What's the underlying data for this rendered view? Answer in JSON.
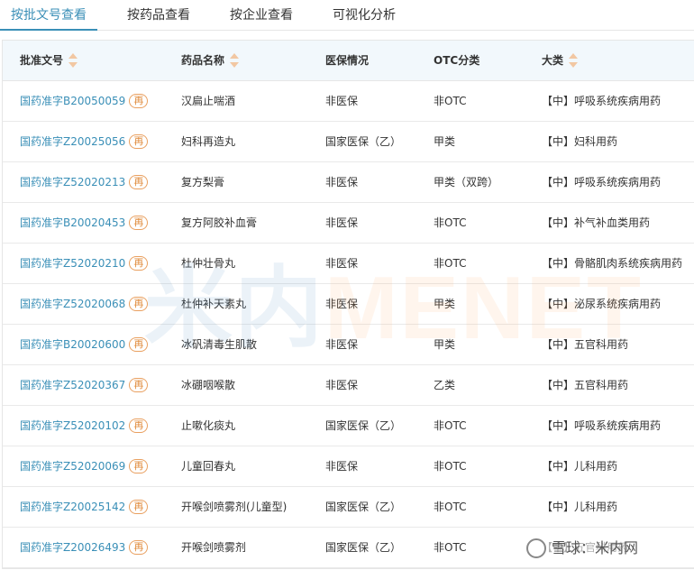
{
  "tabs": [
    {
      "label": "按批文号查看",
      "active": true
    },
    {
      "label": "按药品查看",
      "active": false
    },
    {
      "label": "按企业查看",
      "active": false
    },
    {
      "label": "可视化分析",
      "active": false
    }
  ],
  "columns": [
    "批准文号",
    "药品名称",
    "医保情况",
    "OTC分类",
    "大类"
  ],
  "badge_label": "再",
  "rows": [
    {
      "approval": "国药准字B20050059",
      "name": "汉扁止喘酒",
      "insurance": "非医保",
      "otc": "非OTC",
      "category": "【中】呼吸系统疾病用药"
    },
    {
      "approval": "国药准字Z20025056",
      "name": "妇科再造丸",
      "insurance": "国家医保（乙）",
      "otc": "甲类",
      "category": "【中】妇科用药"
    },
    {
      "approval": "国药准字Z52020213",
      "name": "复方梨膏",
      "insurance": "非医保",
      "otc": "甲类（双跨）",
      "category": "【中】呼吸系统疾病用药"
    },
    {
      "approval": "国药准字B20020453",
      "name": "复方阿胶补血膏",
      "insurance": "非医保",
      "otc": "非OTC",
      "category": "【中】补气补血类用药"
    },
    {
      "approval": "国药准字Z52020210",
      "name": "杜仲壮骨丸",
      "insurance": "非医保",
      "otc": "非OTC",
      "category": "【中】骨骼肌肉系统疾病用药"
    },
    {
      "approval": "国药准字Z52020068",
      "name": "杜仲补天素丸",
      "insurance": "非医保",
      "otc": "甲类",
      "category": "【中】泌尿系统疾病用药"
    },
    {
      "approval": "国药准字B20020600",
      "name": "冰矾清毒生肌散",
      "insurance": "非医保",
      "otc": "甲类",
      "category": "【中】五官科用药"
    },
    {
      "approval": "国药准字Z52020367",
      "name": "冰硼咽喉散",
      "insurance": "非医保",
      "otc": "乙类",
      "category": "【中】五官科用药"
    },
    {
      "approval": "国药准字Z52020102",
      "name": "止嗽化痰丸",
      "insurance": "国家医保（乙）",
      "otc": "非OTC",
      "category": "【中】呼吸系统疾病用药"
    },
    {
      "approval": "国药准字Z52020069",
      "name": "儿童回春丸",
      "insurance": "非医保",
      "otc": "非OTC",
      "category": "【中】儿科用药"
    },
    {
      "approval": "国药准字Z20025142",
      "name": "开喉剑喷雾剂(儿童型)",
      "insurance": "国家医保（乙）",
      "otc": "非OTC",
      "category": "【中】儿科用药"
    },
    {
      "approval": "国药准字Z20026493",
      "name": "开喉剑喷雾剂",
      "insurance": "国家医保（乙）",
      "otc": "非OTC",
      "category": "【中】五官科用药"
    }
  ],
  "watermark": {
    "cn": "米内",
    "en": "MENET"
  },
  "footer_watermark": "雪球：米内网"
}
